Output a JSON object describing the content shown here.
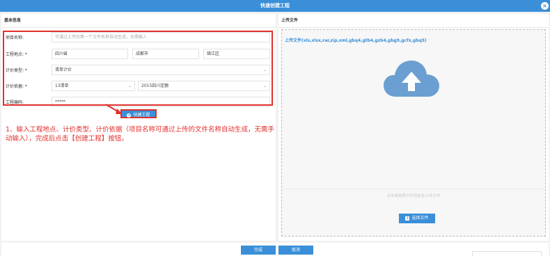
{
  "window": {
    "title": "快速创建工程",
    "close_symbol": "×"
  },
  "basic_info": {
    "heading": "基本信息",
    "project_name": {
      "label": "项目名称:",
      "placeholder": "可通过上传的第一个文件名称自动生成，无需输入"
    },
    "location": {
      "label": "工程地点: *",
      "province": "四川省",
      "city": "成都市",
      "district": "锦江区"
    },
    "pricing_type": {
      "label": "计价类型: *",
      "value": "清单计价"
    },
    "pricing_basis": {
      "label": "计价依据: *",
      "standard": "13清单",
      "quota": "2015四川定额"
    },
    "project_code": {
      "label": "工程编码:",
      "value": "*****"
    },
    "create_button": "创建工程"
  },
  "instruction": "1、输入工程地点、计价类型、计价依据（项目名称可通过上传的文件名称自动生成，无需手动输入），完成后点击【创建工程】按钮。",
  "upload": {
    "heading": "上传文件",
    "accepted_types": "上传文件(xls,xlsx,rar,zip,xml,gbq4,gtb4,gzb4,gbg9,gcfx,gbq5)",
    "drop_hint": "点击或拖拽文件到此处上传文件",
    "choose_button": "选择文件",
    "cloud_color": "#6b9fd1"
  },
  "footer": {
    "finish_button": "完成",
    "cancel_button": "取消"
  },
  "colors": {
    "accent": "#3a8fd8",
    "highlight": "#e0302b"
  }
}
